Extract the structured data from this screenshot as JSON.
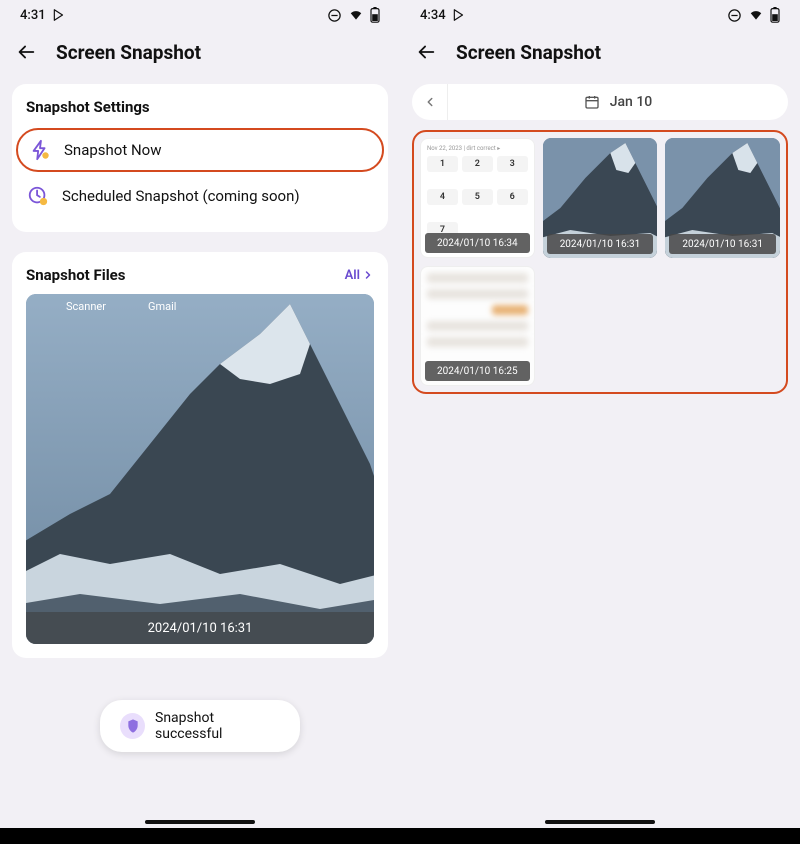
{
  "left": {
    "time": "4:31",
    "title": "Screen Snapshot",
    "settings_header": "Snapshot Settings",
    "snapshot_now": "Snapshot Now",
    "scheduled": "Scheduled Snapshot (coming soon)",
    "files_header": "Snapshot Files",
    "all_label": "All",
    "preview_apps": {
      "a": "Scanner",
      "b": "Gmail"
    },
    "preview_caption": "2024/01/10 16:31",
    "toast": "Snapshot successful"
  },
  "right": {
    "time": "4:34",
    "title": "Screen Snapshot",
    "date_label": "Jan 10",
    "thumbs": [
      {
        "caption": "2024/01/10 16:34",
        "kind": "dialer"
      },
      {
        "caption": "2024/01/10 16:31",
        "kind": "mountain"
      },
      {
        "caption": "2024/01/10 16:31",
        "kind": "mountain"
      },
      {
        "caption": "2024/01/10 16:25",
        "kind": "blur"
      }
    ],
    "dialer_keys": [
      "1",
      "2",
      "3",
      "4",
      "5",
      "6",
      "7"
    ]
  }
}
